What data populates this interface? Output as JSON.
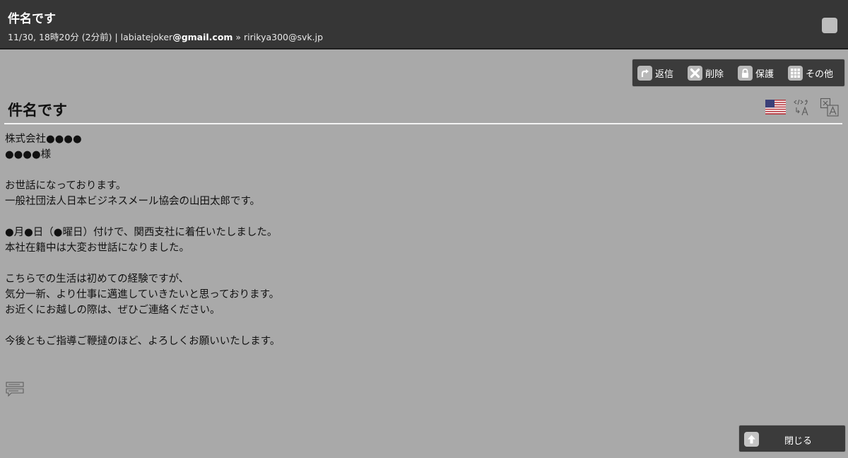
{
  "header": {
    "title": "件名です",
    "date": "11/30, 18時20分 (2分前)",
    "separator": " | ",
    "from_user": "labiatejoker",
    "from_domain": "@gmail.com",
    "arrow": " » ",
    "to": "ririkya300@svk.jp"
  },
  "toolbar": {
    "reply_label": "返信",
    "delete_label": "削除",
    "protect_label": "保護",
    "other_label": "その他"
  },
  "message": {
    "subject": "件名です",
    "paragraphs": [
      [
        "株式会社●●●●",
        "●●●●様"
      ],
      [
        "お世話になっております。",
        "一般社団法人日本ビジネスメール協会の山田太郎です。"
      ],
      [
        "●月●日（●曜日）付けで、関西支社に着任いたしました。",
        "本社在籍中は大変お世話になりました。"
      ],
      [
        "こちらでの生活は初めての経験ですが、",
        "気分一新、より仕事に邁進していきたいと思っております。",
        "お近くにお越しの際は、ぜひご連絡ください。"
      ],
      [
        "今後ともご指導ご鞭撻のほど、よろしくお願いいたします。"
      ]
    ]
  },
  "footer": {
    "close_label": "閉じる"
  },
  "icons": {
    "reply": "reply-icon",
    "delete": "delete-icon",
    "protect": "lock-icon",
    "other": "grid-icon",
    "flag": "us-flag-icon",
    "translate": "translate-icon",
    "languages": "language-switch-icon",
    "compose": "reply-compose-icon",
    "close": "arrow-up-icon"
  },
  "colors": {
    "background": "#a9a9a9",
    "header": "#363636",
    "button": "#3b3b3b",
    "icon_bg": "#b8b8b8"
  }
}
